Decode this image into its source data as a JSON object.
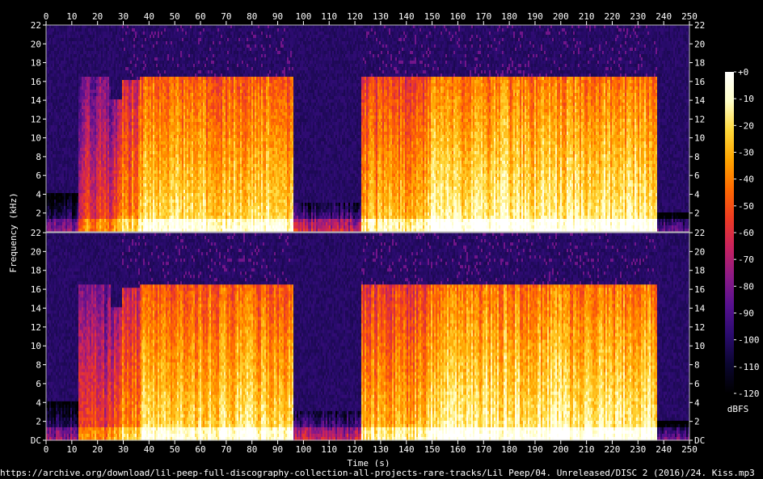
{
  "chart_data": {
    "type": "heatmap",
    "title": "",
    "xlabel": "Time (s)",
    "ylabel": "Frequency (kHz)",
    "x_range": [
      0,
      250
    ],
    "x_ticks": [
      0,
      10,
      20,
      30,
      40,
      50,
      60,
      70,
      80,
      90,
      100,
      110,
      120,
      130,
      140,
      150,
      160,
      170,
      180,
      190,
      200,
      210,
      220,
      230,
      240,
      250
    ],
    "y_range_khz": [
      0,
      22
    ],
    "channels": [
      {
        "name": "channel-1",
        "y_ticks": [
          "22",
          "20",
          "18",
          "16",
          "14",
          "12",
          "10",
          "8",
          "6",
          "4",
          "2"
        ]
      },
      {
        "name": "channel-2",
        "y_ticks": [
          "22",
          "20",
          "18",
          "16",
          "14",
          "12",
          "10",
          "8",
          "6",
          "4",
          "2",
          "DC"
        ]
      }
    ],
    "colorbar": {
      "label": "dBFS",
      "range": [
        -120,
        0
      ],
      "ticks": [
        "+0",
        "-10",
        "-20",
        "-30",
        "-40",
        "-50",
        "-60",
        "-70",
        "-80",
        "-90",
        "-100",
        "-110",
        "-120"
      ],
      "colors": [
        "#000000",
        "#0b0630",
        "#2a0b6e",
        "#56108f",
        "#8c1a86",
        "#c8225e",
        "#ee3b22",
        "#ff6a00",
        "#ffa500",
        "#ffd83a",
        "#ffffc8",
        "#ffffff"
      ]
    },
    "segments": [
      {
        "t0": 0,
        "t1": 12,
        "cutoff_khz": 4,
        "level": 0.25
      },
      {
        "t0": 12,
        "t1": 25,
        "cutoff_khz": 16.5,
        "level": 0.55
      },
      {
        "t0": 25,
        "t1": 29,
        "cutoff_khz": 14,
        "level": 0.6
      },
      {
        "t0": 29,
        "t1": 36,
        "cutoff_khz": 16.3,
        "level": 0.72
      },
      {
        "t0": 36,
        "t1": 96,
        "cutoff_khz": 16.5,
        "level": 0.85
      },
      {
        "t0": 96,
        "t1": 122,
        "cutoff_khz": 3,
        "level": 0.35
      },
      {
        "t0": 122,
        "t1": 148,
        "cutoff_khz": 16.5,
        "level": 0.78
      },
      {
        "t0": 148,
        "t1": 237,
        "cutoff_khz": 16.5,
        "level": 0.9
      },
      {
        "t0": 237,
        "t1": 250,
        "cutoff_khz": 2,
        "level": 0.2
      }
    ]
  },
  "footer": {
    "path": "https://archive.org/download/lil-peep-full-discography-collection-all-projects-rare-tracks/Lil Peep/04. Unreleased/DISC 2 (2016)/24. Kiss.mp3"
  }
}
